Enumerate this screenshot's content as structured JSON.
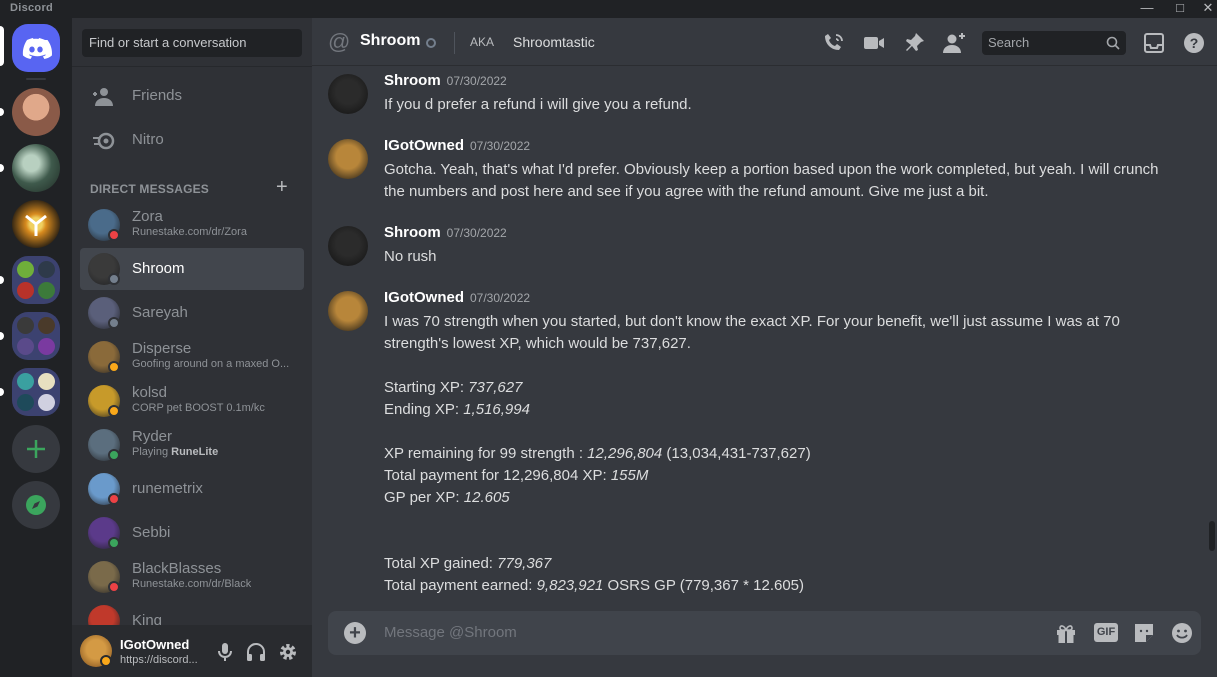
{
  "window": {
    "app_name": "Discord",
    "controls": [
      "minimize",
      "maximize",
      "close"
    ]
  },
  "guilds": {
    "items": [
      {
        "name": "home-discord",
        "color": "#5865f2"
      },
      {
        "name": "server-avatar-1",
        "color": "#c98c6e"
      },
      {
        "name": "server-avatar-2",
        "color": "#5d7a6a"
      },
      {
        "name": "server-avatar-3",
        "color": "#d78a1e"
      },
      {
        "name": "folder-1"
      },
      {
        "name": "folder-2"
      },
      {
        "name": "folder-3"
      },
      {
        "name": "add-server"
      },
      {
        "name": "explore-servers"
      }
    ]
  },
  "sidebar": {
    "search_placeholder": "Find or start a conversation",
    "nav": [
      {
        "label": "Friends",
        "icon": "friends-icon"
      },
      {
        "label": "Nitro",
        "icon": "nitro-icon"
      }
    ],
    "dm_header": "DIRECT MESSAGES",
    "dms": [
      {
        "name": "Zora",
        "sub": "Runestake.com/dr/Zora",
        "status": "dnd",
        "avatar_color": "#4a6b8a"
      },
      {
        "name": "Shroom",
        "sub": "",
        "status": "offline",
        "avatar_color": "#3a3a3a"
      },
      {
        "name": "Sareyah",
        "sub": "",
        "status": "offline",
        "avatar_color": "#5a5f7a"
      },
      {
        "name": "Disperse",
        "sub": "Goofing around on a maxed O...",
        "status": "idle",
        "avatar_color": "#8a6a3a"
      },
      {
        "name": "kolsd",
        "sub": "CORP pet BOOST 0.1m/kc",
        "status": "idle",
        "avatar_color": "#c79a2a"
      },
      {
        "name": "Ryder",
        "sub_prefix": "Playing ",
        "sub_bold": "RuneLite",
        "status": "online",
        "avatar_color": "#5b6e7e"
      },
      {
        "name": "runemetrix",
        "sub": "",
        "status": "dnd",
        "avatar_color": "#6a9acb"
      },
      {
        "name": "Sebbi",
        "sub": "",
        "status": "online",
        "avatar_color": "#5b3a8a"
      },
      {
        "name": "BlackBlasses",
        "sub": "Runestake.com/dr/Black",
        "status": "dnd",
        "avatar_color": "#7a6a4a"
      },
      {
        "name": "King",
        "sub": "",
        "status": "dnd",
        "avatar_color": "#c0392b"
      }
    ]
  },
  "user_panel": {
    "name": "IGotOwned",
    "sub": "https://discord...",
    "status": "idle"
  },
  "header": {
    "title": "Shroom",
    "aka_label": "AKA",
    "aka_value": "Shroomtastic",
    "search_placeholder": "Search",
    "icons": [
      "voice-call-icon",
      "video-call-icon",
      "pinned-icon",
      "add-friend-icon",
      "search-icon",
      "inbox-icon",
      "help-icon"
    ]
  },
  "messages": [
    {
      "author": "Shroom",
      "timestamp": "07/30/2022",
      "avatar_color": "#2b2b2b",
      "lines": [
        "If you d prefer a refund i will give you a refund."
      ]
    },
    {
      "author": "IGotOwned",
      "timestamp": "07/30/2022",
      "avatar_color": "#b8863a",
      "lines": [
        "Gotcha. Yeah, that's what I'd prefer. Obviously keep a portion based upon the work completed, but yeah. I will crunch",
        "the numbers and post here and see if you agree with the refund amount. Give me just a bit."
      ]
    },
    {
      "author": "Shroom",
      "timestamp": "07/30/2022",
      "avatar_color": "#2b2b2b",
      "lines": [
        "No rush"
      ]
    },
    {
      "author": "IGotOwned",
      "timestamp": "07/30/2022",
      "avatar_color": "#b8863a",
      "lines": [
        {
          "text": "I was 70 strength when you started, but don't know the exact XP. For your benefit, we'll just assume I was at 70"
        },
        {
          "text": "strength's lowest XP, which would be 737,627."
        },
        {
          "text": ""
        },
        {
          "text": "Starting XP: ",
          "em": "737,627",
          "after": ""
        },
        {
          "text": "Ending XP: ",
          "em": "1,516,994",
          "after": ""
        },
        {
          "text": ""
        },
        {
          "text": "XP remaining for 99 strength : ",
          "em": "12,296,804",
          "after": " (13,034,431-737,627)"
        },
        {
          "text": "Total payment for 12,296,804 XP: ",
          "em": "155M",
          "after": ""
        },
        {
          "text": "GP per XP: ",
          "em": "12.605",
          "after": ""
        },
        {
          "text": ""
        },
        {
          "text": ""
        },
        {
          "text": "Total XP gained: ",
          "em": "779,367",
          "after": ""
        },
        {
          "text": "Total payment earned: ",
          "em": "9,823,921",
          "after": " OSRS GP (779,367 * 12.605)"
        }
      ]
    }
  ],
  "composer": {
    "placeholder": "Message @Shroom",
    "icons": [
      "gift-icon",
      "gif-icon",
      "sticker-icon",
      "emoji-icon"
    ],
    "gif_label": "GIF"
  },
  "colors": {
    "blurple": "#5865f2",
    "online": "#3ba55d",
    "idle": "#faa81a",
    "dnd": "#ed4245",
    "offline": "#747f8d"
  }
}
